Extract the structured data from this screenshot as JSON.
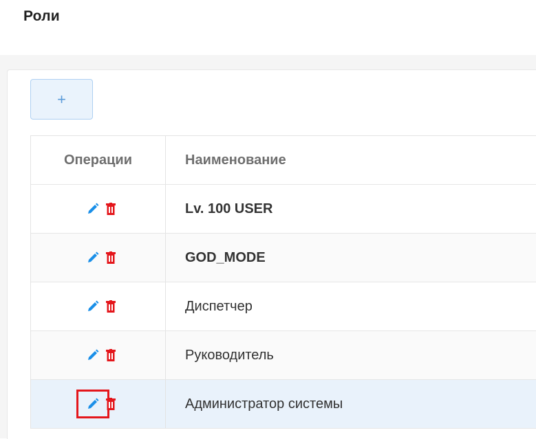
{
  "page": {
    "title": "Роли"
  },
  "toolbar": {
    "add_label": "+"
  },
  "table": {
    "columns": {
      "operations": "Операции",
      "name": "Наименование"
    },
    "rows": [
      {
        "name": "Lv. 100 USER",
        "bold": true
      },
      {
        "name": "GOD_MODE",
        "bold": true
      },
      {
        "name": "Диспетчер",
        "bold": false
      },
      {
        "name": "Руководитель",
        "bold": false
      },
      {
        "name": "Администратор системы",
        "bold": false,
        "selected": true
      }
    ]
  },
  "icons": {
    "edit": "pencil-icon",
    "delete": "trash-icon"
  },
  "colors": {
    "edit_icon": "#1a8fe8",
    "delete_icon": "#e4161b",
    "highlight_border": "#e4161b",
    "selected_row": "#e9f2fb",
    "add_button_bg": "#eaf3fc",
    "add_button_border": "#aed0f2"
  }
}
